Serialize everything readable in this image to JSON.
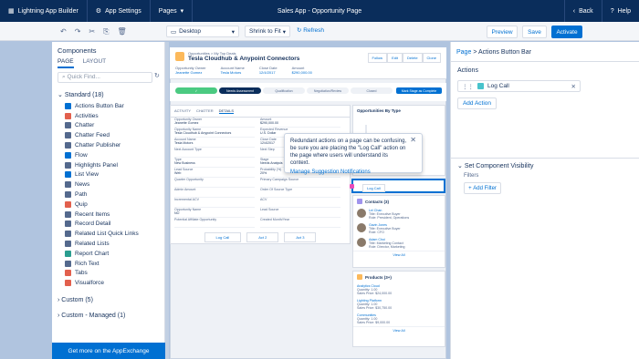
{
  "topbar": {
    "app_name": "Lightning App Builder",
    "settings": "App Settings",
    "pages": "Pages",
    "title": "Sales App - Opportunity Page",
    "back": "Back",
    "help": "Help"
  },
  "toolbar": {
    "device": "Desktop",
    "shrink": "Shrink to Fit",
    "refresh": "Refresh",
    "preview": "Preview",
    "save": "Save",
    "activate": "Activate"
  },
  "components_panel": {
    "title": "Components",
    "tab_page": "PAGE",
    "tab_layout": "LAYOUT",
    "search_placeholder": "Quick Find...",
    "standard_header": "Standard (18)",
    "items": [
      {
        "label": "Actions Button Bar",
        "color": "#0070d2"
      },
      {
        "label": "Activities",
        "color": "#e2604d"
      },
      {
        "label": "Chatter",
        "color": "#54698d"
      },
      {
        "label": "Chatter Feed",
        "color": "#54698d"
      },
      {
        "label": "Chatter Publisher",
        "color": "#54698d"
      },
      {
        "label": "Flow",
        "color": "#0070d2"
      },
      {
        "label": "Highlights Panel",
        "color": "#54698d"
      },
      {
        "label": "List View",
        "color": "#0070d2"
      },
      {
        "label": "News",
        "color": "#54698d"
      },
      {
        "label": "Path",
        "color": "#54698d"
      },
      {
        "label": "Quip",
        "color": "#e2604d"
      },
      {
        "label": "Recent Items",
        "color": "#54698d"
      },
      {
        "label": "Record Detail",
        "color": "#54698d"
      },
      {
        "label": "Related List Quick Links",
        "color": "#54698d"
      },
      {
        "label": "Related Lists",
        "color": "#54698d"
      },
      {
        "label": "Report Chart",
        "color": "#2a9d8f"
      },
      {
        "label": "Rich Text",
        "color": "#54698d"
      },
      {
        "label": "Tabs",
        "color": "#e2604d"
      },
      {
        "label": "Visualforce",
        "color": "#e2604d"
      }
    ],
    "custom_header": "Custom (5)",
    "custom_managed_header": "Custom - Managed (1)",
    "footer": "Get more on the AppExchange"
  },
  "record": {
    "breadcrumb": "Opportunities > My Top Deals",
    "title": "Tesla Cloudhub & Anypoint Connectors",
    "actions": [
      "Follow",
      "Edit",
      "Delete",
      "Clone"
    ],
    "fields": [
      {
        "label": "Opportunity Owner",
        "value": "Jeanette Gomez"
      },
      {
        "label": "Account Name",
        "value": "Tesla Motors"
      },
      {
        "label": "Close Date",
        "value": "12/4/2017"
      },
      {
        "label": "Amount",
        "value": "$290,000.00"
      }
    ],
    "path_steps": [
      "",
      "Needs Assessment",
      "Qualification",
      "Negotiation/Review",
      "Closed"
    ],
    "path_button": "Mark Stage as Complete",
    "detail_tabs": [
      "ACTIVITY",
      "CHATTER",
      "DETAILS"
    ],
    "detail_rows": [
      [
        {
          "label": "Opportunity Owner",
          "value": "Jeanette Gomez"
        },
        {
          "label": "Amount",
          "value": "$290,000.00"
        }
      ],
      [
        {
          "label": "Opportunity Name",
          "value": "Tesla Cloudhub & Anypoint Connectors"
        },
        {
          "label": "Expected Revenue",
          "value": "U.S. Dollar"
        }
      ],
      [
        {
          "label": "Account Name",
          "value": "Tesla Motors"
        },
        {
          "label": "Close Date",
          "value": "12/4/2017"
        }
      ],
      [
        {
          "label": "Next Account Type",
          "value": ""
        },
        {
          "label": "Next Step",
          "value": ""
        }
      ],
      [
        {
          "label": "Type",
          "value": "New Business"
        },
        {
          "label": "Stage",
          "value": "Needs Analysis"
        }
      ],
      [
        {
          "label": "Lead Source",
          "value": "Web"
        },
        {
          "label": "Probability (%)",
          "value": "20%"
        }
      ],
      [
        {
          "label": "Quarter Opportunity",
          "value": ""
        },
        {
          "label": "Primary Campaign Source",
          "value": ""
        }
      ],
      [
        {
          "label": "Admin Amount",
          "value": ""
        },
        {
          "label": "Order Of Source Type",
          "value": ""
        }
      ],
      [
        {
          "label": "Incremental ACV",
          "value": ""
        },
        {
          "label": "ACV",
          "value": ""
        }
      ],
      [
        {
          "label": "Opportunity Name",
          "value": "NO"
        },
        {
          "label": "Lead Source",
          "value": ""
        }
      ],
      [
        {
          "label": "Potential Affiliate Opportunity",
          "value": ""
        },
        {
          "label": "Created Month/Year",
          "value": ""
        }
      ]
    ],
    "detail_buttons": [
      "Log Call",
      "Act 2",
      "Act 3"
    ],
    "chart_card_title": "Opportunities By Type",
    "selected_action": "Log Call",
    "contacts_title": "Contacts (3)",
    "contacts": [
      {
        "name": "Lei Chan",
        "title": "Title:",
        "title_val": "Executive Buyer",
        "role": "Role:",
        "role_val": "President, Operations"
      },
      {
        "name": "Gavin Jones",
        "title": "Title:",
        "title_val": "Executive Buyer",
        "role": "Role:",
        "role_val": "CFO"
      },
      {
        "name": "Adam Choi",
        "title": "Title:",
        "title_val": "Marketing Contact",
        "role": "Role:",
        "role_val": "Director, Marketing"
      }
    ],
    "view_all": "View All",
    "products_title": "Products (3+)",
    "products": [
      {
        "name": "Analytics Cloud",
        "q": "Quantity: 1.00",
        "s": "Sales Price: $24,000.00"
      },
      {
        "name": "Lighting Platform",
        "q": "Quantity: 1.00",
        "s": "Sales Price: $30,750.00"
      },
      {
        "name": "Communities",
        "q": "Quantity: 1.00",
        "s": "Sales Price: $9,000.00"
      }
    ]
  },
  "popover": {
    "text": "Redundant actions on a page can be confusing, be sure you are placing the \"Log Call\" action on the page where users will understand its context.",
    "link": "Manage Suggestion Notifications"
  },
  "properties": {
    "breadcrumb_page": "Page",
    "breadcrumb_sep": ">",
    "breadcrumb_current": "Actions Button Bar",
    "actions_label": "Actions",
    "action_item": "Log Call",
    "add_action": "Add Action",
    "visibility_label": "Set Component Visibility",
    "filters_label": "Filters",
    "add_filter": "Add Filter"
  }
}
